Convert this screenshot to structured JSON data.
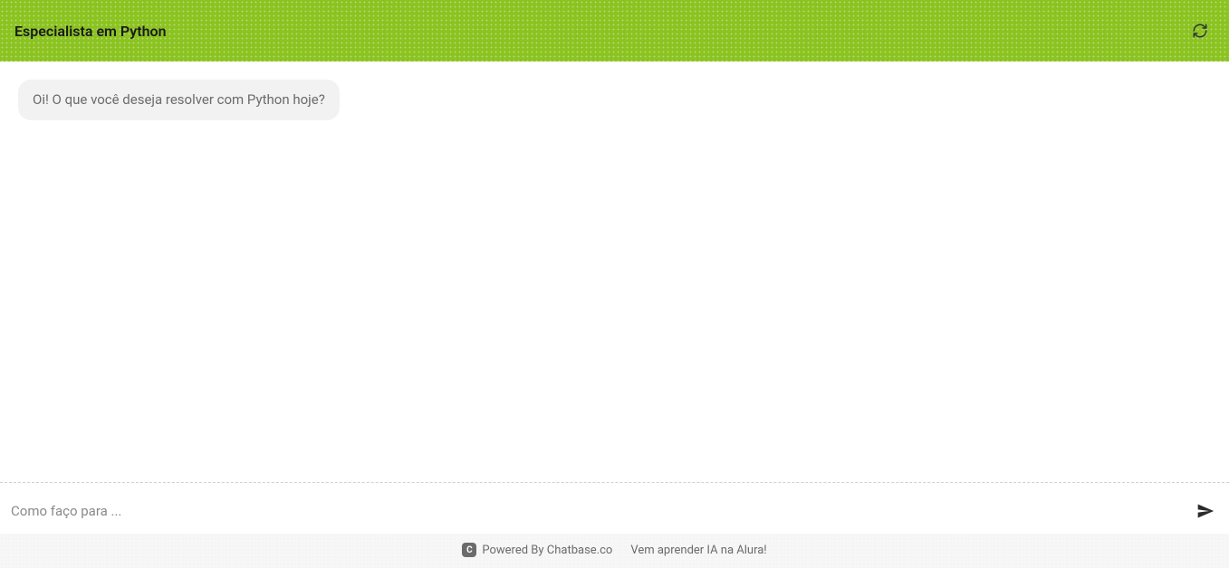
{
  "header": {
    "title": "Especialista em Python"
  },
  "chat": {
    "messages": [
      {
        "role": "assistant",
        "text": "Oi! O que você deseja resolver com Python hoje?"
      }
    ]
  },
  "input": {
    "placeholder": "Como faço para ...",
    "value": ""
  },
  "footer": {
    "powered_by": "Powered By Chatbase.co",
    "brand_badge": "C",
    "link_text": "Vem aprender IA na Alura!"
  },
  "colors": {
    "accent": "#8bc321"
  }
}
